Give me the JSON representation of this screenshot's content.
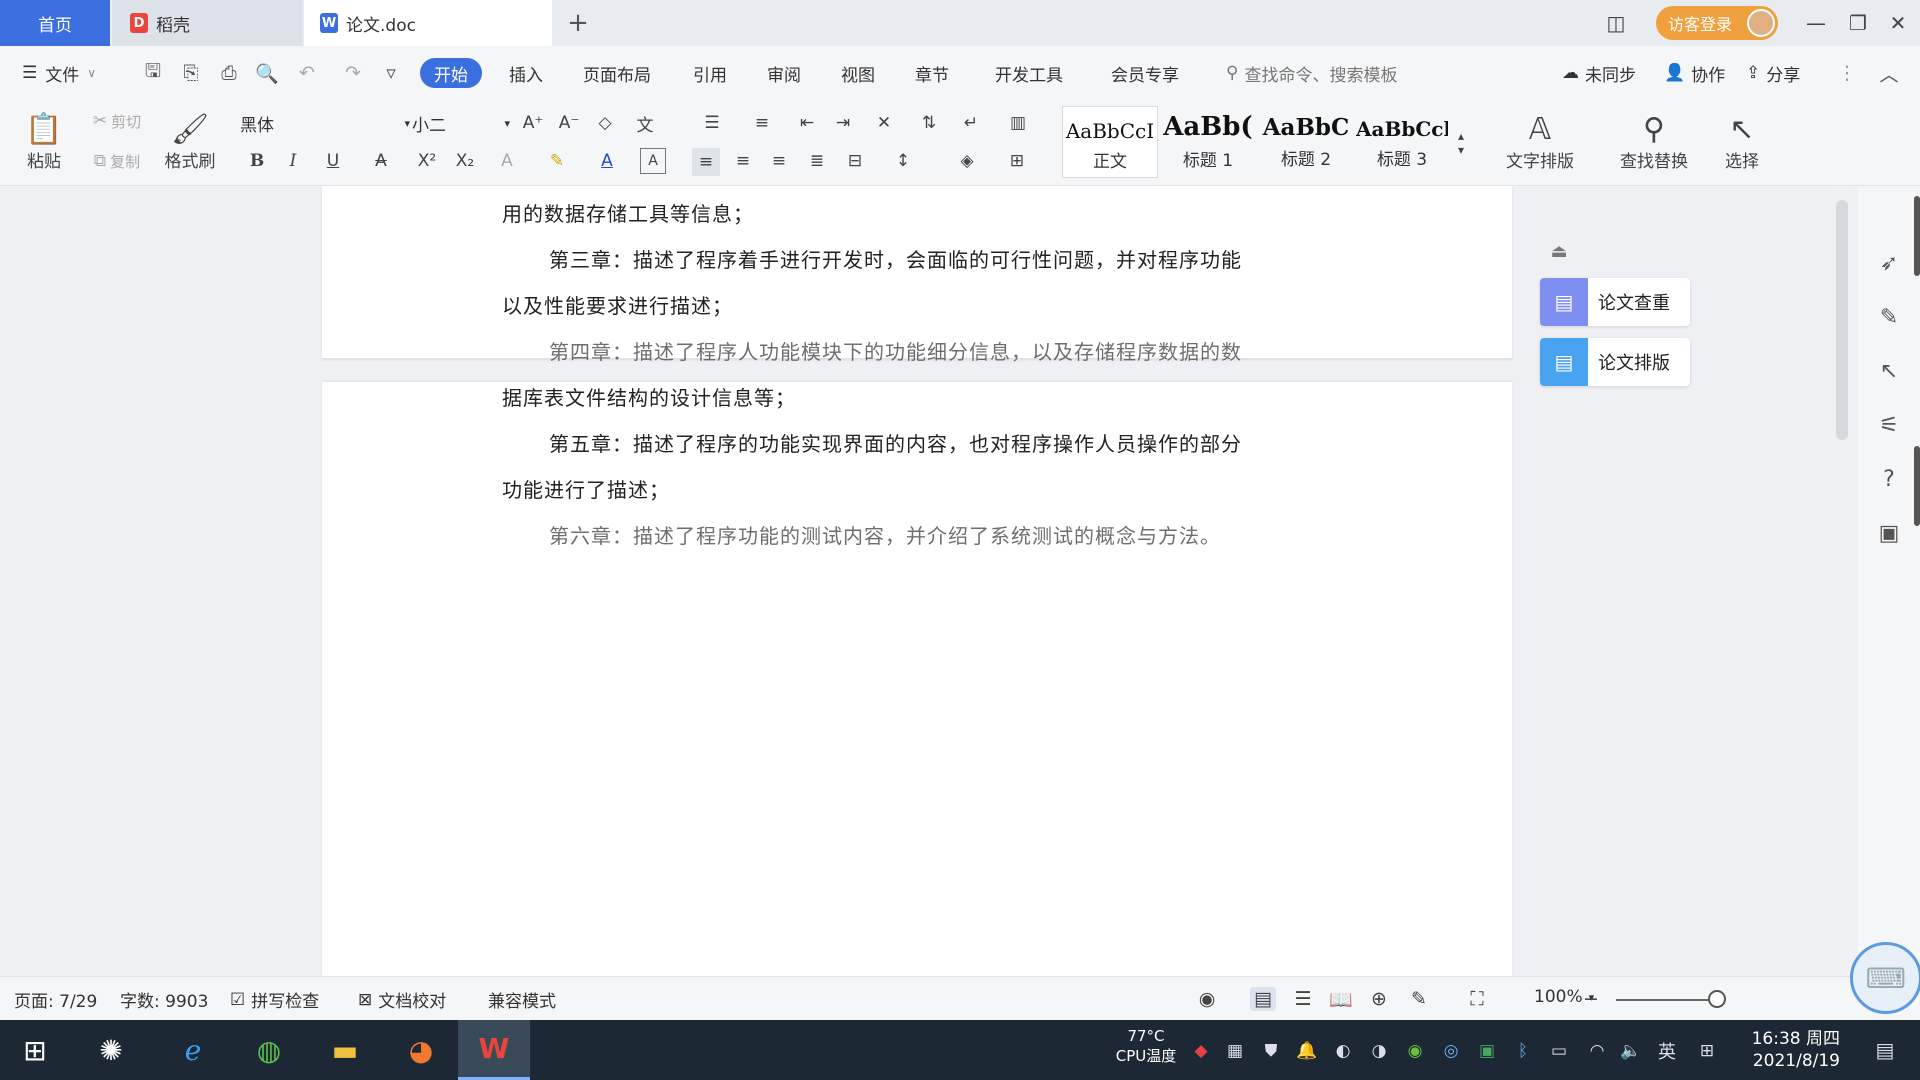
{
  "titlebar": {
    "tab_home": "首页",
    "tab_daoke": "稻壳",
    "tab_doc": "论文.doc",
    "add_tab": "+",
    "login": "访客登录"
  },
  "menu": {
    "file": "文件",
    "tabs": [
      "开始",
      "插入",
      "页面布局",
      "引用",
      "审阅",
      "视图",
      "章节",
      "开发工具",
      "会员专享"
    ],
    "search_cmd": "查找命令、搜索模板",
    "sync": "未同步",
    "collab": "协作",
    "share": "分享"
  },
  "toolbar": {
    "paste": "粘贴",
    "cut": "剪切",
    "copy": "复制",
    "format_painter": "格式刷",
    "font_name": "黑体",
    "font_size": "小二",
    "styles": [
      {
        "sample": "AaBbCcI",
        "name": "正文"
      },
      {
        "sample": "AaBb(",
        "name": "标题 1"
      },
      {
        "sample": "AaBbC",
        "name": "标题 2"
      },
      {
        "sample": "AaBbCcl",
        "name": "标题 3"
      }
    ],
    "text_layout": "文字排版",
    "find_replace": "查找替换",
    "select": "选择"
  },
  "document": {
    "lines": [
      "用的数据存储工具等信息；",
      "第三章：描述了程序着手进行开发时，会面临的可行性问题，并对程序功能",
      "以及性能要求进行描述；",
      "第四章：描述了程序人功能模块下的功能细分信息，以及存储程序数据的数",
      "据库表文件结构的设计信息等；",
      "第五章：描述了程序的功能实现界面的内容，也对程序操作人员操作的部分",
      "功能进行了描述；",
      "第六章：描述了程序功能的测试内容，并介绍了系统测试的概念与方法。"
    ]
  },
  "sidepanel": {
    "check": "论文查重",
    "layout": "论文排版"
  },
  "status": {
    "page": "页面: 7/29",
    "words": "字数: 9903",
    "spellcheck": "拼写检查",
    "proofread": "文档校对",
    "compat": "兼容模式",
    "zoom": "100%",
    "zoom_level": 100
  },
  "taskbar": {
    "cpu_temp": "77°C",
    "cpu_label": "CPU温度",
    "ime": "英",
    "time": "16:38 周四",
    "date": "2021/8/19"
  },
  "colors": {
    "accent": "#3b6fe0",
    "login": "#f0a03c",
    "taskbar": "#1c2833",
    "check_icon": "#7f8ff0",
    "layout_icon": "#4aa3f0"
  }
}
